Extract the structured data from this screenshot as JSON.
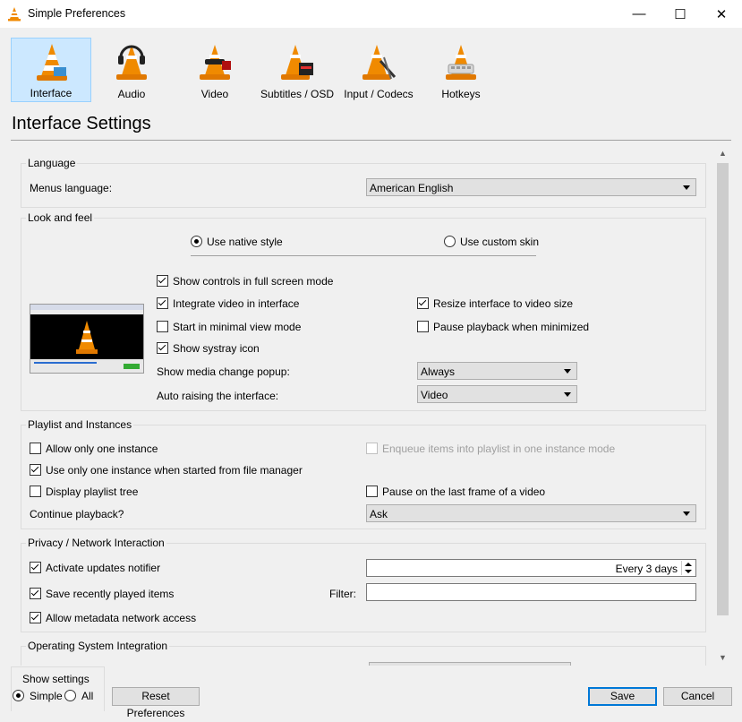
{
  "window": {
    "title": "Simple Preferences",
    "minimize": "—",
    "maximize": "☐",
    "close": "✕"
  },
  "categories": [
    {
      "label": "Interface",
      "selected": true
    },
    {
      "label": "Audio"
    },
    {
      "label": "Video"
    },
    {
      "label": "Subtitles / OSD"
    },
    {
      "label": "Input / Codecs"
    },
    {
      "label": "Hotkeys"
    }
  ],
  "heading": "Interface Settings",
  "language": {
    "title": "Language",
    "menus_label": "Menus language:",
    "menus_value": "American English"
  },
  "look": {
    "title": "Look and feel",
    "native_style": "Use native style",
    "custom_skin": "Use custom skin",
    "fullscreen_controls": "Show controls in full screen mode",
    "integrate_video": "Integrate video in interface",
    "resize_interface": "Resize interface to video size",
    "minimal_view": "Start in minimal view mode",
    "pause_minimized": "Pause playback when minimized",
    "systray": "Show systray icon",
    "media_popup_label": "Show media change popup:",
    "media_popup_value": "Always",
    "auto_raise_label": "Auto raising the interface:",
    "auto_raise_value": "Video"
  },
  "playlist": {
    "title": "Playlist and Instances",
    "one_instance": "Allow only one instance",
    "enqueue": "Enqueue items into playlist in one instance mode",
    "file_manager": "Use only one instance when started from file manager",
    "playlist_tree": "Display playlist tree",
    "pause_last_frame": "Pause on the last frame of a video",
    "continue_label": "Continue playback?",
    "continue_value": "Ask"
  },
  "privacy": {
    "title": "Privacy / Network Interaction",
    "updates": "Activate updates notifier",
    "updates_value": "Every 3 days",
    "recent": "Save recently played items",
    "filter_label": "Filter:",
    "filter_value": "",
    "metadata": "Allow metadata network access"
  },
  "os": {
    "title": "Operating System Integration"
  },
  "bottom": {
    "show_settings": "Show settings",
    "simple": "Simple",
    "all": "All",
    "reset": "Reset Preferences",
    "save": "Save",
    "cancel": "Cancel"
  },
  "colors": {
    "accent": "#0078d7",
    "selection_bg": "#cce8ff",
    "cone_orange": "#f08a00"
  },
  "icons": {
    "app": "vlc-cone-icon",
    "scroll_up": "▲",
    "scroll_down": "▼"
  }
}
